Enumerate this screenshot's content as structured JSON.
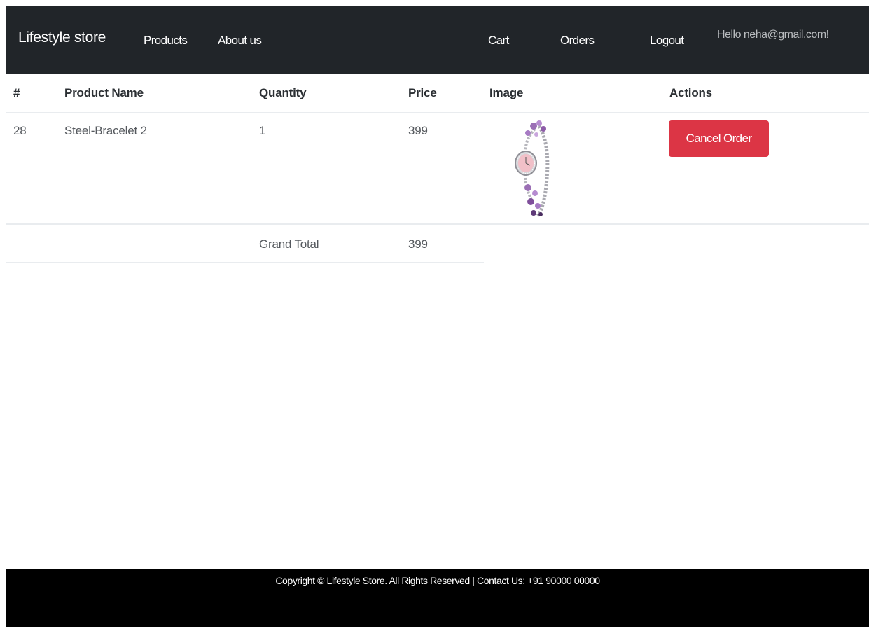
{
  "navbar": {
    "brand": "Lifestyle store",
    "links": {
      "products": "Products",
      "about": "About us",
      "cart": "Cart",
      "orders": "Orders",
      "logout": "Logout"
    },
    "greeting": "Hello neha@gmail.com!"
  },
  "orders_table": {
    "headers": {
      "number": "#",
      "product_name": "Product Name",
      "quantity": "Quantity",
      "price": "Price",
      "image": "Image",
      "actions": "Actions"
    },
    "rows": [
      {
        "number": "28",
        "product_name": "Steel-Bracelet 2",
        "quantity": "1",
        "price": "399",
        "image_icon": "bracelet-watch-image",
        "action_label": "Cancel Order"
      }
    ],
    "grand_total_label": "Grand Total",
    "grand_total_value": "399"
  },
  "footer": {
    "text": "Copyright © Lifestyle Store. All Rights Reserved | Contact Us: +91 90000 00000"
  },
  "colors": {
    "navbar_bg": "#212529",
    "footer_bg": "#000000",
    "danger": "#dc3545",
    "greeting": "#b9bcbf"
  }
}
